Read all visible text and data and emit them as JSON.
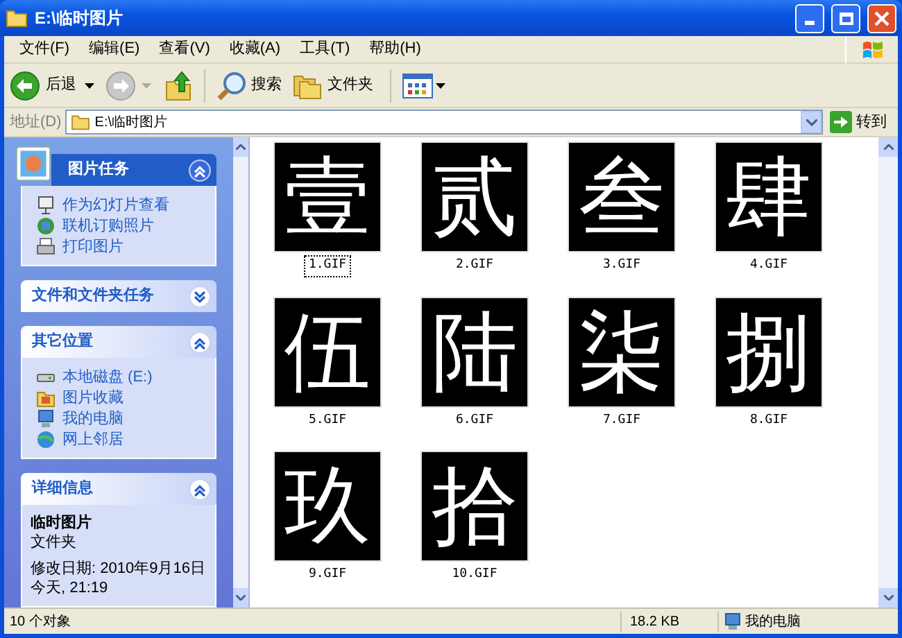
{
  "window": {
    "title": "E:\\临时图片"
  },
  "menu": [
    "文件(F)",
    "编辑(E)",
    "查看(V)",
    "收藏(A)",
    "工具(T)",
    "帮助(H)"
  ],
  "toolbar": {
    "back": "后退",
    "search": "搜索",
    "folders": "文件夹"
  },
  "address": {
    "label": "地址(D)",
    "value": "E:\\临时图片",
    "go": "转到"
  },
  "sidebar": [
    {
      "kind": "special",
      "title": "图片任务",
      "expanded": true,
      "items": [
        {
          "kind": "slideshow",
          "label": "作为幻灯片查看"
        },
        {
          "kind": "order",
          "label": "联机订购照片"
        },
        {
          "kind": "print",
          "label": "打印图片"
        }
      ]
    },
    {
      "kind": "normal",
      "title": "文件和文件夹任务",
      "expanded": false
    },
    {
      "kind": "normal",
      "title": "其它位置",
      "expanded": true,
      "items": [
        {
          "kind": "drive",
          "label": "本地磁盘 (E:)"
        },
        {
          "kind": "pictures",
          "label": "图片收藏"
        },
        {
          "kind": "computer",
          "label": "我的电脑"
        },
        {
          "kind": "network",
          "label": "网上邻居"
        }
      ]
    },
    {
      "kind": "details",
      "title": "详细信息",
      "expanded": true,
      "name": "临时图片",
      "type": "文件夹",
      "modified": "修改日期: 2010年9月16日",
      "time": "今天, 21:19"
    }
  ],
  "files": [
    {
      "name": "1.GIF",
      "glyph": "壹",
      "selected": true
    },
    {
      "name": "2.GIF",
      "glyph": "贰",
      "selected": false
    },
    {
      "name": "3.GIF",
      "glyph": "叁",
      "selected": false
    },
    {
      "name": "4.GIF",
      "glyph": "肆",
      "selected": false
    },
    {
      "name": "5.GIF",
      "glyph": "伍",
      "selected": false
    },
    {
      "name": "6.GIF",
      "glyph": "陆",
      "selected": false
    },
    {
      "name": "7.GIF",
      "glyph": "柒",
      "selected": false
    },
    {
      "name": "8.GIF",
      "glyph": "捌",
      "selected": false
    },
    {
      "name": "9.GIF",
      "glyph": "玖",
      "selected": false
    },
    {
      "name": "10.GIF",
      "glyph": "拾",
      "selected": false
    }
  ],
  "status_bar": {
    "count": "10 个对象",
    "size": "18.2 KB",
    "zone": "我的电脑"
  }
}
